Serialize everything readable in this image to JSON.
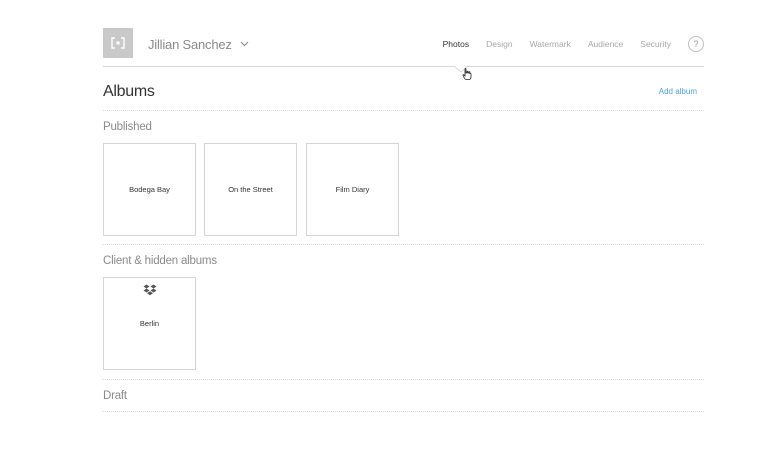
{
  "header": {
    "user_name": "Jillian Sanchez",
    "nav": [
      "Photos",
      "Design",
      "Watermark",
      "Audience",
      "Security"
    ],
    "active_nav": "Photos",
    "help_label": "?"
  },
  "albums": {
    "title": "Albums",
    "add_label": "Add album"
  },
  "sections": {
    "published": {
      "label": "Published",
      "albums": [
        "Bodega Bay",
        "On the Street",
        "Film Diary"
      ]
    },
    "client_hidden": {
      "label": "Client & hidden albums",
      "albums": [
        "Berlin"
      ]
    },
    "draft": {
      "label": "Draft"
    }
  },
  "colors": {
    "accent": "#4aa3df",
    "logo_bg": "#c9c9c9"
  }
}
